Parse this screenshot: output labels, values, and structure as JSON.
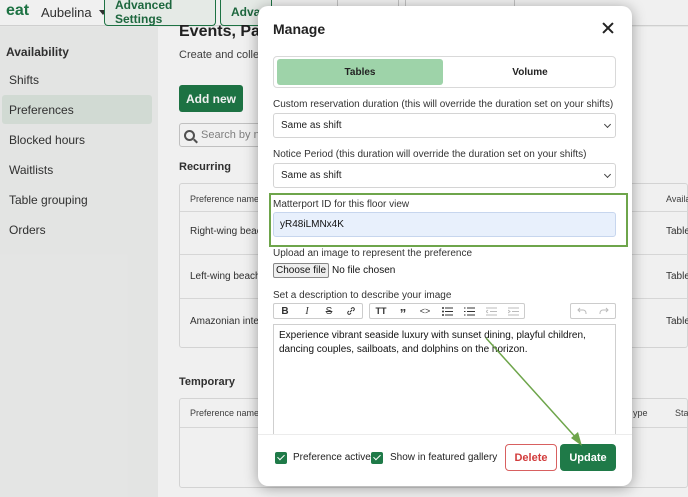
{
  "app": {
    "logo": "eat",
    "venue": "Aubelina",
    "top_tabs": [
      "Advanced Settings",
      "Advan"
    ]
  },
  "sidebar": {
    "section_title": "Availability",
    "items": [
      "Shifts",
      "Preferences",
      "Blocked hours",
      "Waitlists",
      "Table grouping",
      "Orders"
    ],
    "active": "Preferences"
  },
  "main": {
    "title": "Events, Pack",
    "description": "Create and collect p",
    "add_new_label": "Add new",
    "search_placeholder": "Search by na",
    "recurring_label": "Recurring",
    "recurring_table": {
      "col_preference": "Preference name",
      "col_availability": "Availa",
      "rows": [
        {
          "name": "Right-wing beac",
          "availability": "Table"
        },
        {
          "name": "Left-wing beach",
          "availability": "Table"
        },
        {
          "name": "Amazonian inter",
          "availability": "Table"
        }
      ]
    },
    "temporary_label": "Temporary",
    "temporary_table": {
      "col_preference": "Preference name",
      "col_type": "ype",
      "col_status": "Sta"
    }
  },
  "modal": {
    "title": "Manage",
    "tabs": [
      {
        "label": "Tables",
        "selected": true
      },
      {
        "label": "Volume",
        "selected": false
      }
    ],
    "reservation_duration": {
      "label": "Custom reservation duration (this will override the duration set on your shifts)",
      "value": "Same as shift"
    },
    "notice_period": {
      "label": "Notice Period (this duration will override the duration set on your shifts)",
      "value": "Same as shift"
    },
    "matterport": {
      "label": "Matterport ID for this floor view",
      "value": "yR48iLMNx4K"
    },
    "upload": {
      "label": "Upload an image to represent the preference",
      "button_label": "Choose file",
      "status": "No file chosen"
    },
    "description": {
      "label": "Set a description to describe your image",
      "toolbar": {
        "bold": "B",
        "italic": "I",
        "strike": "S",
        "heading": "TT",
        "quote": "”",
        "code": "<>"
      },
      "text": "Experience vibrant seaside luxury with sunset dining, playful children, dancing couples, sailboats, and dolphins on the horizon."
    },
    "checkboxes": [
      {
        "label": "Preference active",
        "checked": true
      },
      {
        "label": "Show in featured gallery",
        "checked": true
      }
    ],
    "delete_label": "Delete",
    "update_label": "Update"
  },
  "colors": {
    "brand_green": "#1f7a48",
    "tab_selected": "#9ed3a9",
    "highlight": "#6ea54b",
    "delete_red": "#d23c3c"
  }
}
